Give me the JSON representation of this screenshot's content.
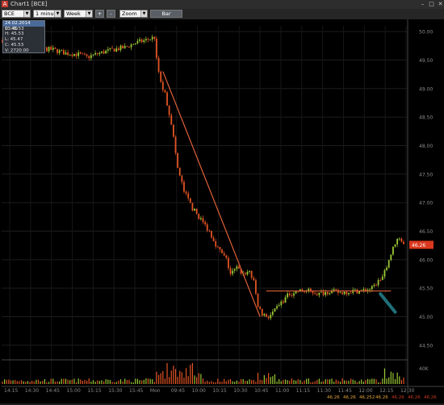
{
  "window": {
    "title": "Chart1 [BCE]",
    "min": "–",
    "max": "□",
    "close": "✕"
  },
  "toolbar": {
    "symbol": "BCE",
    "interval": "1 minute",
    "period": "Week",
    "plus": "+",
    "minus": "-",
    "zoom": "Zoom",
    "bar": "Bar"
  },
  "ohlc_box": {
    "header": "24.02.2014 13:40",
    "open": "O: 45.53",
    "high": "H: 45.53",
    "low": "L: 45.47",
    "close": "C: 45.53",
    "volume": "V: 2720.00"
  },
  "chart_data": {
    "type": "candlestick",
    "yticks": [
      "50.00",
      "49.50",
      "49.00",
      "48.50",
      "48.00",
      "47.50",
      "47.00",
      "46.50",
      "46.00",
      "45.50",
      "45.00",
      "44.50"
    ],
    "ylim": [
      44.3,
      50.1
    ],
    "xticks": [
      "14:15",
      "14:30",
      "14:45",
      "15:00",
      "15:15",
      "15:30",
      "15:45",
      "Mon",
      "09:45",
      "10:00",
      "10:15",
      "10:30",
      "10:45",
      "11:00",
      "11:15",
      "11:30",
      "11:45",
      "12:00",
      "12:15",
      "12:30"
    ],
    "current_price": "46.26",
    "volume_axis_label": "40K",
    "bottom_prices": [
      "46.26",
      "46.26",
      "46.252",
      "46.26",
      "46.26",
      "46.26",
      "46.26"
    ],
    "price_path": [
      [
        0,
        49.85
      ],
      [
        6,
        49.8
      ],
      [
        12,
        49.75
      ],
      [
        18,
        49.7
      ],
      [
        24,
        49.68
      ],
      [
        30,
        49.62
      ],
      [
        36,
        49.6
      ],
      [
        40,
        49.55
      ],
      [
        46,
        49.62
      ],
      [
        52,
        49.68
      ],
      [
        58,
        49.72
      ],
      [
        63,
        49.8
      ],
      [
        68,
        49.85
      ],
      [
        72,
        49.9
      ],
      [
        73,
        49.5
      ],
      [
        75,
        49.1
      ],
      [
        77,
        48.9
      ],
      [
        80,
        48.4
      ],
      [
        83,
        47.6
      ],
      [
        86,
        47.2
      ],
      [
        90,
        46.9
      ],
      [
        94,
        46.7
      ],
      [
        98,
        46.5
      ],
      [
        102,
        46.2
      ],
      [
        106,
        46.0
      ],
      [
        108,
        45.75
      ],
      [
        111,
        45.85
      ],
      [
        114,
        45.75
      ],
      [
        117,
        45.8
      ],
      [
        119,
        45.6
      ],
      [
        121,
        45.2
      ],
      [
        123,
        45.05
      ],
      [
        126,
        45.0
      ],
      [
        129,
        45.1
      ],
      [
        132,
        45.25
      ],
      [
        136,
        45.4
      ],
      [
        140,
        45.45
      ],
      [
        145,
        45.45
      ],
      [
        150,
        45.4
      ],
      [
        155,
        45.45
      ],
      [
        160,
        45.42
      ],
      [
        165,
        45.45
      ],
      [
        170,
        45.45
      ],
      [
        175,
        45.5
      ],
      [
        180,
        45.7
      ],
      [
        183,
        46.0
      ],
      [
        186,
        46.3
      ],
      [
        188,
        46.4
      ],
      [
        190,
        46.26
      ]
    ],
    "annotations": [
      {
        "type": "trendline",
        "color": "#e0603a",
        "from": [
          76,
          49.3
        ],
        "to": [
          122,
          45.0
        ]
      },
      {
        "type": "horizontal",
        "color": "#e0603a",
        "from": [
          125,
          45.45
        ],
        "to": [
          184,
          45.45
        ]
      }
    ]
  }
}
